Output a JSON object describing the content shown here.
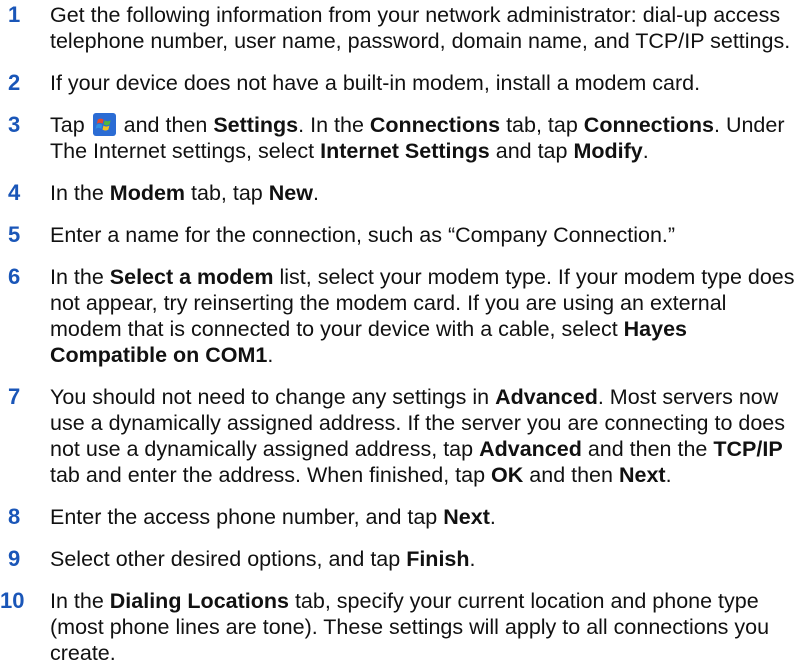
{
  "steps": [
    {
      "number": "1",
      "text": "Get the following information from your network administrator: dial-up access telephone number, user name, password, domain name, and TCP/IP settings."
    },
    {
      "number": "2",
      "text": "If your device does not have a built-in modem, install a modem card."
    },
    {
      "number": "3",
      "p1": "Tap",
      "icon": "windows-start-icon",
      "p2": "and then",
      "b1": "Settings",
      "p3": ". In the",
      "b2": "Connections",
      "p4": "tab, tap",
      "b3": "Connections",
      "p5": ". Under The Internet settings, select",
      "b4": "Internet Settings",
      "p6": "and tap",
      "b5": "Modify",
      "p7": "."
    },
    {
      "number": "4",
      "p1": "In the",
      "b1": "Modem",
      "p2": "tab, tap",
      "b2": "New",
      "p3": "."
    },
    {
      "number": "5",
      "text": "Enter a name for the connection, such as “Company Connection.”"
    },
    {
      "number": "6",
      "p1": "In the",
      "b1": "Select a modem",
      "p2": "list, select your modem type. If your modem type does not appear, try reinserting the modem card. If you are using an external modem that is connected to your device with a cable, select",
      "b2": "Hayes Compatible on COM1",
      "p3": "."
    },
    {
      "number": "7",
      "p1": "You should not need to change any settings in",
      "b1": "Advanced",
      "p2": ". Most servers now use a dynamically assigned address. If the server you are connecting to does not use a dynamically assigned address, tap",
      "b2": "Advanced",
      "p3": "and then the",
      "b3": "TCP/IP",
      "p4": "tab and enter the address. When finished, tap",
      "b4": "OK",
      "p5": "and then",
      "b5": "Next",
      "p6": "."
    },
    {
      "number": "8",
      "p1": "Enter the access phone number, and tap",
      "b1": "Next",
      "p2": "."
    },
    {
      "number": "9",
      "p1": "Select other desired options, and tap",
      "b1": "Finish",
      "p2": "."
    },
    {
      "number": "10",
      "p1": "In the",
      "b1": "Dialing Locations",
      "p2": "tab, specify your current location and phone type (most phone lines are tone). These settings will apply to all connections you create."
    }
  ],
  "colors": {
    "step_number": "#1a56b8",
    "body_text": "#111111"
  }
}
